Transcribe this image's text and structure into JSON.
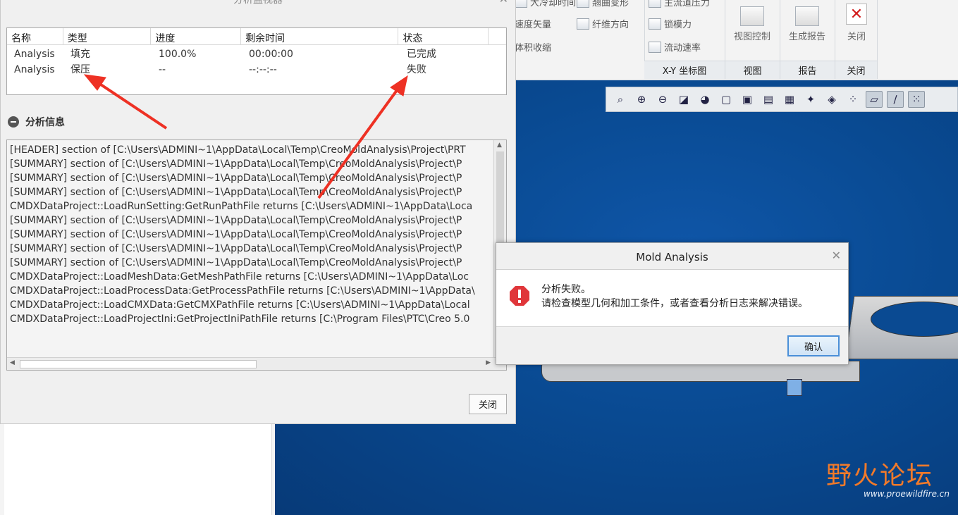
{
  "ribbon": {
    "items": [
      {
        "label": "大冷却时间",
        "icon": "cooling-time-icon"
      },
      {
        "label": "翘曲变形",
        "icon": "warpage-icon"
      },
      {
        "label": "主流道压力",
        "icon": "sprue-pressure-icon"
      },
      {
        "label": "速度矢量",
        "icon": "velocity-vector-icon"
      },
      {
        "label": "纤维方向",
        "icon": "fiber-direction-icon"
      },
      {
        "label": "锁模力",
        "icon": "clamp-force-icon"
      },
      {
        "label": "体积收缩",
        "icon": "volumetric-shrinkage-icon"
      },
      {
        "label": "流动速率",
        "icon": "flow-rate-icon"
      }
    ],
    "big_buttons": {
      "view_control": "视图控制",
      "report": "生成报告",
      "close": "关闭"
    },
    "groups": {
      "xy": "X-Y 坐标图",
      "view": "视图",
      "report": "报告",
      "close": "关闭"
    }
  },
  "view_toolbar": {
    "icons": [
      "zoom-fit-icon",
      "zoom-in-icon",
      "zoom-out-icon",
      "repaint-icon",
      "display-style-icon",
      "named-views-icon",
      "saved-orientations-icon",
      "snapshot-icon",
      "view-manager-icon",
      "spin-center-icon",
      "perspective-icon",
      "datum-display-icon",
      "plane-display-icon",
      "axis-display-icon",
      "point-display-icon"
    ]
  },
  "monitor": {
    "title": "分析监视器",
    "table": {
      "headers": [
        "名称",
        "类型",
        "进度",
        "剩余时间",
        "状态"
      ],
      "rows": [
        [
          "Analysis",
          "填充",
          "100.0%",
          "00:00:00",
          "已完成"
        ],
        [
          "Analysis",
          "保压",
          "--",
          "--:--:--",
          "失败"
        ]
      ]
    },
    "info_title": "分析信息",
    "log": [
      "[HEADER] section of [C:\\Users\\ADMINI~1\\AppData\\Local\\Temp\\CreoMoldAnalysis\\Project\\PRT",
      "[SUMMARY] section of [C:\\Users\\ADMINI~1\\AppData\\Local\\Temp\\CreoMoldAnalysis\\Project\\P",
      "[SUMMARY] section of [C:\\Users\\ADMINI~1\\AppData\\Local\\Temp\\CreoMoldAnalysis\\Project\\P",
      "[SUMMARY] section of [C:\\Users\\ADMINI~1\\AppData\\Local\\Temp\\CreoMoldAnalysis\\Project\\P",
      "CMDXDataProject::LoadRunSetting:GetRunPathFile returns [C:\\Users\\ADMINI~1\\AppData\\Loca",
      "[SUMMARY] section of [C:\\Users\\ADMINI~1\\AppData\\Local\\Temp\\CreoMoldAnalysis\\Project\\P",
      "[SUMMARY] section of [C:\\Users\\ADMINI~1\\AppData\\Local\\Temp\\CreoMoldAnalysis\\Project\\P",
      "[SUMMARY] section of [C:\\Users\\ADMINI~1\\AppData\\Local\\Temp\\CreoMoldAnalysis\\Project\\P",
      "[SUMMARY] section of [C:\\Users\\ADMINI~1\\AppData\\Local\\Temp\\CreoMoldAnalysis\\Project\\P",
      "CMDXDataProject::LoadMeshData:GetMeshPathFile returns [C:\\Users\\ADMINI~1\\AppData\\Loc",
      "CMDXDataProject::LoadProcessData:GetProcessPathFile returns [C:\\Users\\ADMINI~1\\AppData\\",
      "CMDXDataProject::LoadCMXData:GetCMXPathFile returns [C:\\Users\\ADMINI~1\\AppData\\Local",
      "CMDXDataProject::LoadProjectIni:GetProjectIniPathFile returns [C:\\Program Files\\PTC\\Creo 5.0"
    ],
    "close_label": "关闭"
  },
  "error_dialog": {
    "title": "Mold Analysis",
    "line1": "分析失败。",
    "line2": "请检查模型几何和加工条件，或者查看分析日志来解决错误。",
    "ok_label": "确认",
    "icon": "error-icon",
    "icon_color": "#e0363a"
  },
  "watermark": {
    "text": "野火论坛",
    "url": "www.proewildfire.cn"
  },
  "colors": {
    "annotation_arrow": "#ee3124",
    "viewport_blue": "#094a92",
    "ok_button_border": "#4a8fd8"
  }
}
